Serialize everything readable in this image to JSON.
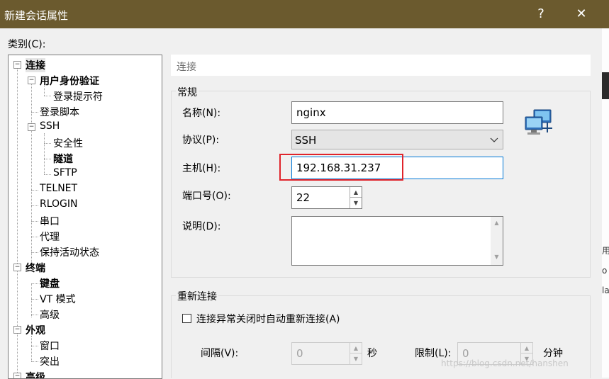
{
  "window": {
    "title": "新建会话属性",
    "help_glyph": "?",
    "close_glyph": "✕"
  },
  "category_label": "类别(C):",
  "tree": {
    "items": [
      {
        "label": "连接"
      },
      {
        "label": "用户身份验证"
      },
      {
        "label": "登录提示符"
      },
      {
        "label": "登录脚本"
      },
      {
        "label": "SSH"
      },
      {
        "label": "安全性"
      },
      {
        "label": "隧道"
      },
      {
        "label": "SFTP"
      },
      {
        "label": "TELNET"
      },
      {
        "label": "RLOGIN"
      },
      {
        "label": "串口"
      },
      {
        "label": "代理"
      },
      {
        "label": "保持活动状态"
      },
      {
        "label": "终端"
      },
      {
        "label": "键盘"
      },
      {
        "label": "VT 模式"
      },
      {
        "label": "高级"
      },
      {
        "label": "外观"
      },
      {
        "label": "窗口"
      },
      {
        "label": "突出"
      },
      {
        "label": "高级"
      }
    ]
  },
  "section_title": "连接",
  "general": {
    "title": "常规",
    "name_label": "名称(N):",
    "name_value": "nginx",
    "protocol_label": "协议(P):",
    "protocol_value": "SSH",
    "host_label": "主机(H):",
    "host_value": "192.168.31.237",
    "port_label": "端口号(O):",
    "port_value": "22",
    "desc_label": "说明(D):",
    "desc_value": ""
  },
  "reconnect": {
    "title": "重新连接",
    "checkbox_label": "连接异常关闭时自动重新连接(A)",
    "checked": false,
    "interval_label": "间隔(V):",
    "interval_value": "0",
    "interval_unit": "秒",
    "limit_label": "限制(L):",
    "limit_value": "0",
    "limit_unit": "分钟"
  },
  "watermark": "https://blog.csdn.net/hanshen",
  "edge_chars": [
    "用",
    "o",
    "la"
  ],
  "icons": {
    "computer": "network-computers-icon"
  }
}
